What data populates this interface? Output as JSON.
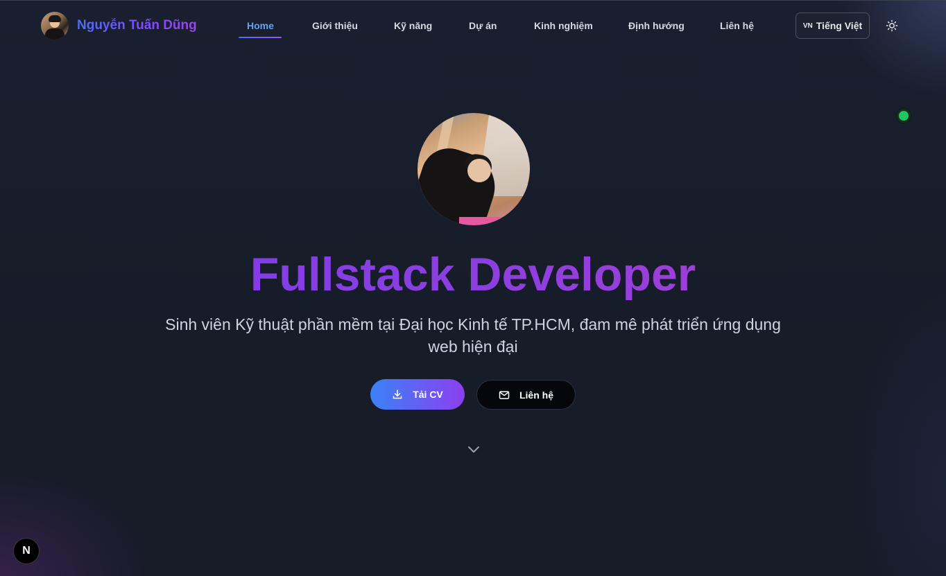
{
  "header": {
    "brand_name": "Nguyễn Tuấn Dũng",
    "nav": [
      {
        "label": "Home",
        "active": true
      },
      {
        "label": "Giới thiệu"
      },
      {
        "label": "Kỹ năng"
      },
      {
        "label": "Dự án"
      },
      {
        "label": "Kinh nghiệm"
      },
      {
        "label": "Định hướng"
      },
      {
        "label": "Liên hệ"
      }
    ],
    "language": {
      "flag": "VN",
      "label": "Tiếng Việt"
    },
    "theme_icon": "sun-icon"
  },
  "hero": {
    "title": "Fullstack Developer",
    "subtitle": "Sinh viên Kỹ thuật phần mềm tại Đại học Kinh tế TP.HCM, đam mê phát triển ứng dụng web hiện đại",
    "primary_button": {
      "label": "Tải CV",
      "icon": "download-icon"
    },
    "secondary_button": {
      "label": "Liên hệ",
      "icon": "mail-icon"
    },
    "scroll_icon": "chevron-down-icon"
  },
  "status": {
    "color": "#22c55e"
  },
  "dev_badge": {
    "label": "N"
  },
  "colors": {
    "accent_blue": "#3b82f6",
    "accent_purple": "#8b3ff0",
    "nav_active": "#60a5fa",
    "background": "#171c29"
  }
}
